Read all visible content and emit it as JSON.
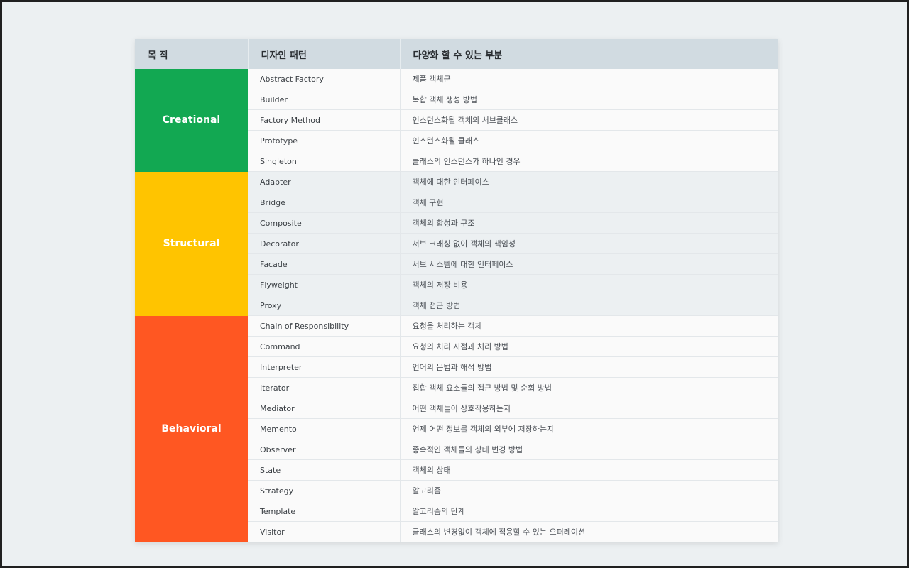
{
  "colors": {
    "creational": "#12a852",
    "structural": "#ffc400",
    "behavioral": "#ff5722",
    "header_bg": "#d1dbe1"
  },
  "table": {
    "headers": [
      "목 적",
      "디자인 패턴",
      "다양화 할 수 있는 부분"
    ],
    "groups": [
      {
        "purpose": "Creational",
        "color_key": "creational",
        "rows": [
          {
            "pattern": "Abstract Factory",
            "variation": "제품 객체군"
          },
          {
            "pattern": "Builder",
            "variation": "복합 객체 생성 방법"
          },
          {
            "pattern": "Factory Method",
            "variation": "인스턴스화될 객체의 서브클래스"
          },
          {
            "pattern": "Prototype",
            "variation": "인스턴스화될 클래스"
          },
          {
            "pattern": "Singleton",
            "variation": "클래스의 인스턴스가 하나인 경우"
          }
        ]
      },
      {
        "purpose": "Structural",
        "color_key": "structural",
        "rows": [
          {
            "pattern": "Adapter",
            "variation": "객체에 대한 인터페이스"
          },
          {
            "pattern": "Bridge",
            "variation": "객체 구현"
          },
          {
            "pattern": "Composite",
            "variation": "객체의 합성과 구조"
          },
          {
            "pattern": "Decorator",
            "variation": "서브 크래싱 없이 객체의 책임성"
          },
          {
            "pattern": "Facade",
            "variation": "서브 시스템에 대한 인터페이스"
          },
          {
            "pattern": "Flyweight",
            "variation": "객체의 저장 비용"
          },
          {
            "pattern": "Proxy",
            "variation": "객체 접근 방법"
          }
        ]
      },
      {
        "purpose": "Behavioral",
        "color_key": "behavioral",
        "rows": [
          {
            "pattern": "Chain of Responsibility",
            "variation": "요청을 처리하는 객체"
          },
          {
            "pattern": "Command",
            "variation": "요청의 처리 시점과 처리 방법"
          },
          {
            "pattern": "Interpreter",
            "variation": "언어의 문법과 해석 방법"
          },
          {
            "pattern": "Iterator",
            "variation": "집합 객체 요소들의 접근 방법 및 순회 방법"
          },
          {
            "pattern": "Mediator",
            "variation": "어떤 객체들이 상호작용하는지"
          },
          {
            "pattern": "Memento",
            "variation": "언제 어떤 정보를 객체의 외부에 저장하는지"
          },
          {
            "pattern": "Observer",
            "variation": "종속적인 객체들의 상태 변경 방법"
          },
          {
            "pattern": "State",
            "variation": "객체의 상태"
          },
          {
            "pattern": "Strategy",
            "variation": "알고리즘"
          },
          {
            "pattern": "Template",
            "variation": "알고리즘의 단계"
          },
          {
            "pattern": "Visitor",
            "variation": "클래스의 변경없이 객체에 적용할 수 있는 오퍼레이션"
          }
        ]
      }
    ]
  }
}
